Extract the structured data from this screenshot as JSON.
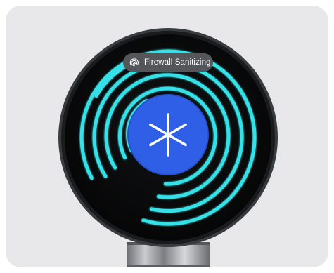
{
  "status_badge": {
    "label": "Firewall Sanitizing",
    "icon": "fingerprint-icon"
  },
  "center_button": {
    "icon": "snowflake-icon"
  },
  "colors": {
    "card_background": "#e8e8ea",
    "device_body": "#0b0b0c",
    "glow_rings": "#35e0e7",
    "center_button": "#2f5fe6",
    "badge_background": "#55565a",
    "connector_metal": "#8d8f95"
  }
}
